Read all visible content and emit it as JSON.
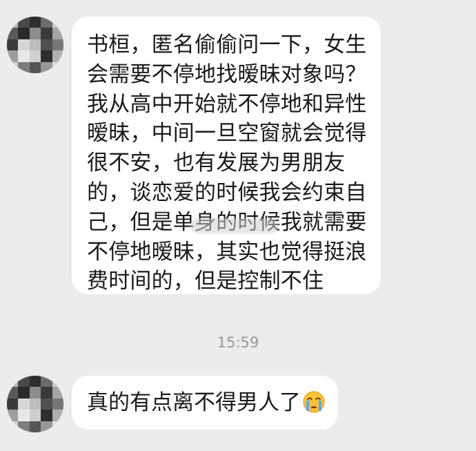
{
  "conversation": {
    "messages": [
      {
        "sender": "other",
        "avatar": "pixelated-avatar",
        "lines": [
          "书桓，匿名偷偷问一下，女生",
          "会需要不停地找暧昧对象吗？",
          "我从高中开始就不停地和异性",
          "暧昧，中间一旦空窗就会觉得",
          "很不安，也有发展为男朋友",
          "的，谈恋爱的时候我会约束自",
          "己，但是单身的时候我就需要",
          "不停地暧昧，其实也觉得挺浪",
          "费时间的，但是控制不住"
        ]
      },
      {
        "sender": "other",
        "avatar": "pixelated-avatar",
        "text": "真的有点离不得男人了",
        "emoji": "loudly-crying-face-icon"
      }
    ],
    "timestamp": "15:59"
  },
  "colors": {
    "background": "#ececec",
    "bubble": "#ffffff",
    "text": "#1a1a1a",
    "timestamp": "#999999"
  }
}
